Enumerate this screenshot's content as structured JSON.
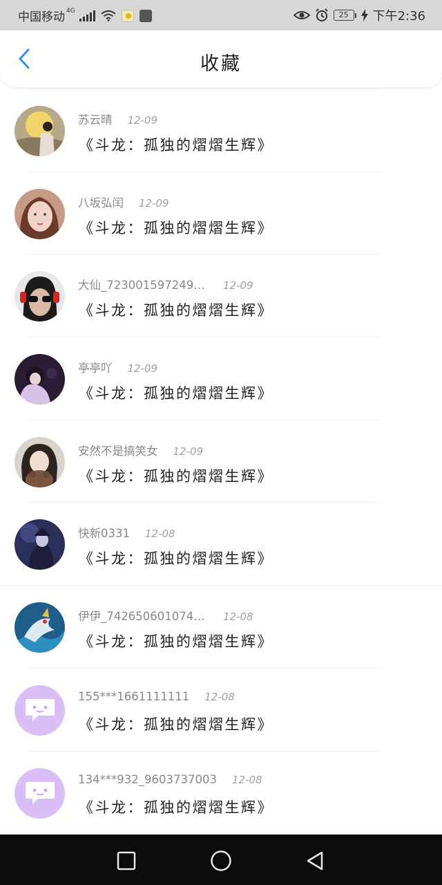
{
  "status_bar": {
    "carrier": "中国移动",
    "network": "4G",
    "battery": "25",
    "time": "下午2:36"
  },
  "header": {
    "title": "收藏"
  },
  "items": [
    {
      "author": "苏云晴",
      "date": "12-09",
      "title": "《斗龙：孤独的熠熠生辉》"
    },
    {
      "author": "八坂弘闰",
      "date": "12-09",
      "title": "《斗龙：孤独的熠熠生辉》"
    },
    {
      "author": "大仙_723001597249…",
      "date": "12-09",
      "title": "《斗龙：孤独的熠熠生辉》"
    },
    {
      "author": "亭亭吖",
      "date": "12-09",
      "title": "《斗龙：孤独的熠熠生辉》"
    },
    {
      "author": "安然不是搞笑女",
      "date": "12-09",
      "title": "《斗龙：孤独的熠熠生辉》"
    },
    {
      "author": "快新0331",
      "date": "12-08",
      "title": "《斗龙：孤独的熠熠生辉》"
    },
    {
      "author": "伊伊_742650601074…",
      "date": "12-08",
      "title": "《斗龙：孤独的熠熠生辉》"
    },
    {
      "author": "155***1661111111",
      "date": "12-08",
      "title": "《斗龙：孤独的熠熠生辉》"
    },
    {
      "author": "134***932_9603737003",
      "date": "12-08",
      "title": "《斗龙：孤独的熠熠生辉》"
    }
  ],
  "colors": {
    "accent": "#2f8ff0",
    "default_avatar": "#d9bff5",
    "status_bar_bg": "#d7d7d7",
    "nav_bar_bg": "#0b0b0b"
  },
  "icons": {
    "back": "chevron-left-icon",
    "nav_recent": "square-icon",
    "nav_home": "circle-icon",
    "nav_back": "triangle-back-icon"
  }
}
